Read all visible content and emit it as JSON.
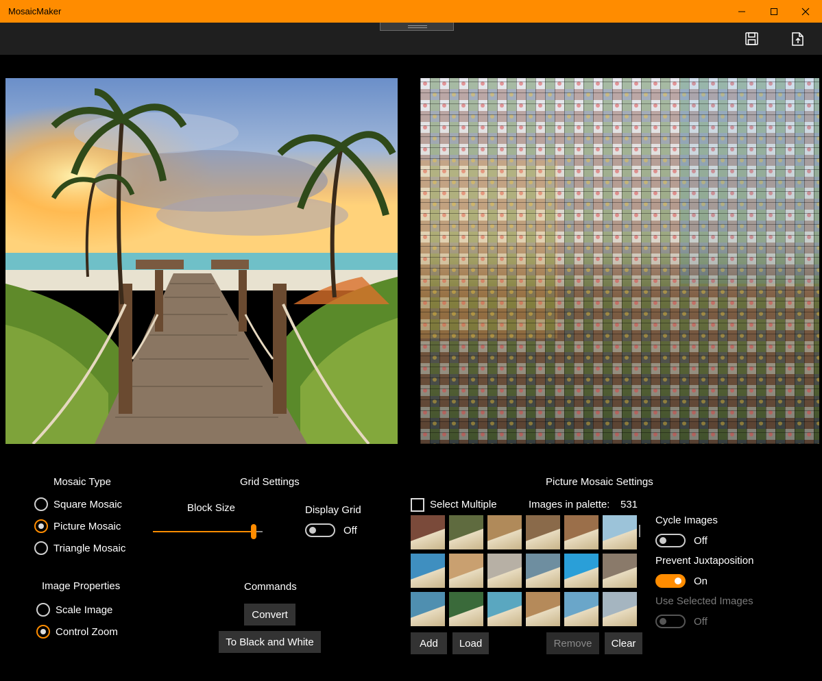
{
  "window": {
    "title": "MosaicMaker",
    "controls": {
      "minimize": "minimize-icon",
      "maximize": "maximize-icon",
      "close": "close-icon"
    }
  },
  "commandbar": {
    "icons": [
      "save-icon",
      "export-icon"
    ]
  },
  "mosaic_type": {
    "header": "Mosaic Type",
    "options": [
      {
        "label": "Square Mosaic",
        "selected": false
      },
      {
        "label": "Picture Mosaic",
        "selected": true
      },
      {
        "label": "Triangle Mosaic",
        "selected": false
      }
    ]
  },
  "image_properties": {
    "header": "Image Properties",
    "options": [
      {
        "label": "Scale Image",
        "selected": false
      },
      {
        "label": "Control Zoom",
        "selected": true
      }
    ]
  },
  "grid_settings": {
    "header": "Grid Settings",
    "block_size_label": "Block Size",
    "block_size_fraction": 0.92,
    "display_grid_label": "Display Grid",
    "display_grid_state": "Off"
  },
  "commands": {
    "header": "Commands",
    "convert_label": "Convert",
    "bw_label": "To Black and White"
  },
  "picture_mosaic_settings": {
    "header": "Picture Mosaic Settings",
    "select_multiple_label": "Select Multiple",
    "palette_label": "Images in palette:",
    "palette_count": "531",
    "cycle_images_label": "Cycle Images",
    "cycle_images_state": "Off",
    "prevent_juxtaposition_label": "Prevent Juxtaposition",
    "prevent_juxtaposition_state": "On",
    "use_selected_label": "Use Selected Images",
    "use_selected_state": "Off",
    "buttons": {
      "add": "Add",
      "load": "Load",
      "remove": "Remove",
      "clear": "Clear"
    },
    "thumbnail_colors": [
      [
        "#7a4a3a",
        "#5f6b3f",
        "#b08a5a",
        "#8a6a4a",
        "#9b6f4a",
        "#9cc3d9"
      ],
      [
        "#3f8fc0",
        "#c9a070",
        "#b7b0a5",
        "#6e8ea0",
        "#2a9fd8",
        "#8a7a6a"
      ],
      [
        "#4f8fb0",
        "#3a6a3a",
        "#5aa7c0",
        "#b58a5a",
        "#6aa6c9",
        "#a5b5c0"
      ]
    ]
  }
}
